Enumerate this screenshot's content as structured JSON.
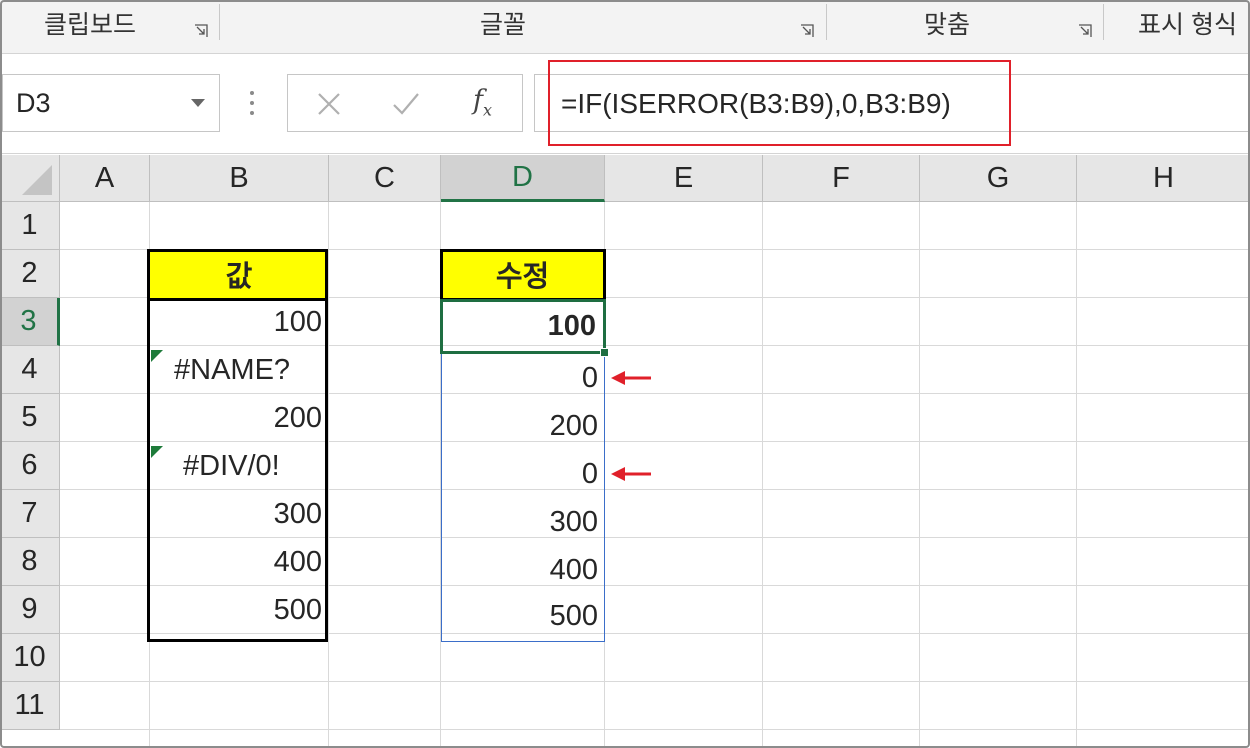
{
  "ribbon": {
    "groups": [
      "클립보드",
      "글꼴",
      "맞춤",
      "표시 형식"
    ]
  },
  "formula_bar": {
    "name_box": "D3",
    "formula": "=IF(ISERROR(B3:B9),0,B3:B9)",
    "fx_label": "f",
    "fx_sub": "x"
  },
  "sheet": {
    "columns": [
      "A",
      "B",
      "C",
      "D",
      "E",
      "F",
      "G",
      "H"
    ],
    "rows": [
      "1",
      "2",
      "3",
      "4",
      "5",
      "6",
      "7",
      "8",
      "9",
      "10",
      "11"
    ],
    "active_cell": "D3",
    "column_b": {
      "header": "값",
      "values": [
        "100",
        "#NAME?",
        "200",
        "#DIV/0!",
        "300",
        "400",
        "500"
      ]
    },
    "column_d": {
      "header": "수정",
      "values": [
        "100",
        "0",
        "200",
        "0",
        "300",
        "400",
        "500"
      ]
    }
  },
  "colors": {
    "header_fill": "#ffff00",
    "highlight_border": "#e0202a",
    "arrow": "#e0202a",
    "selection": "#217346",
    "spill_border": "#3b6ec9"
  }
}
